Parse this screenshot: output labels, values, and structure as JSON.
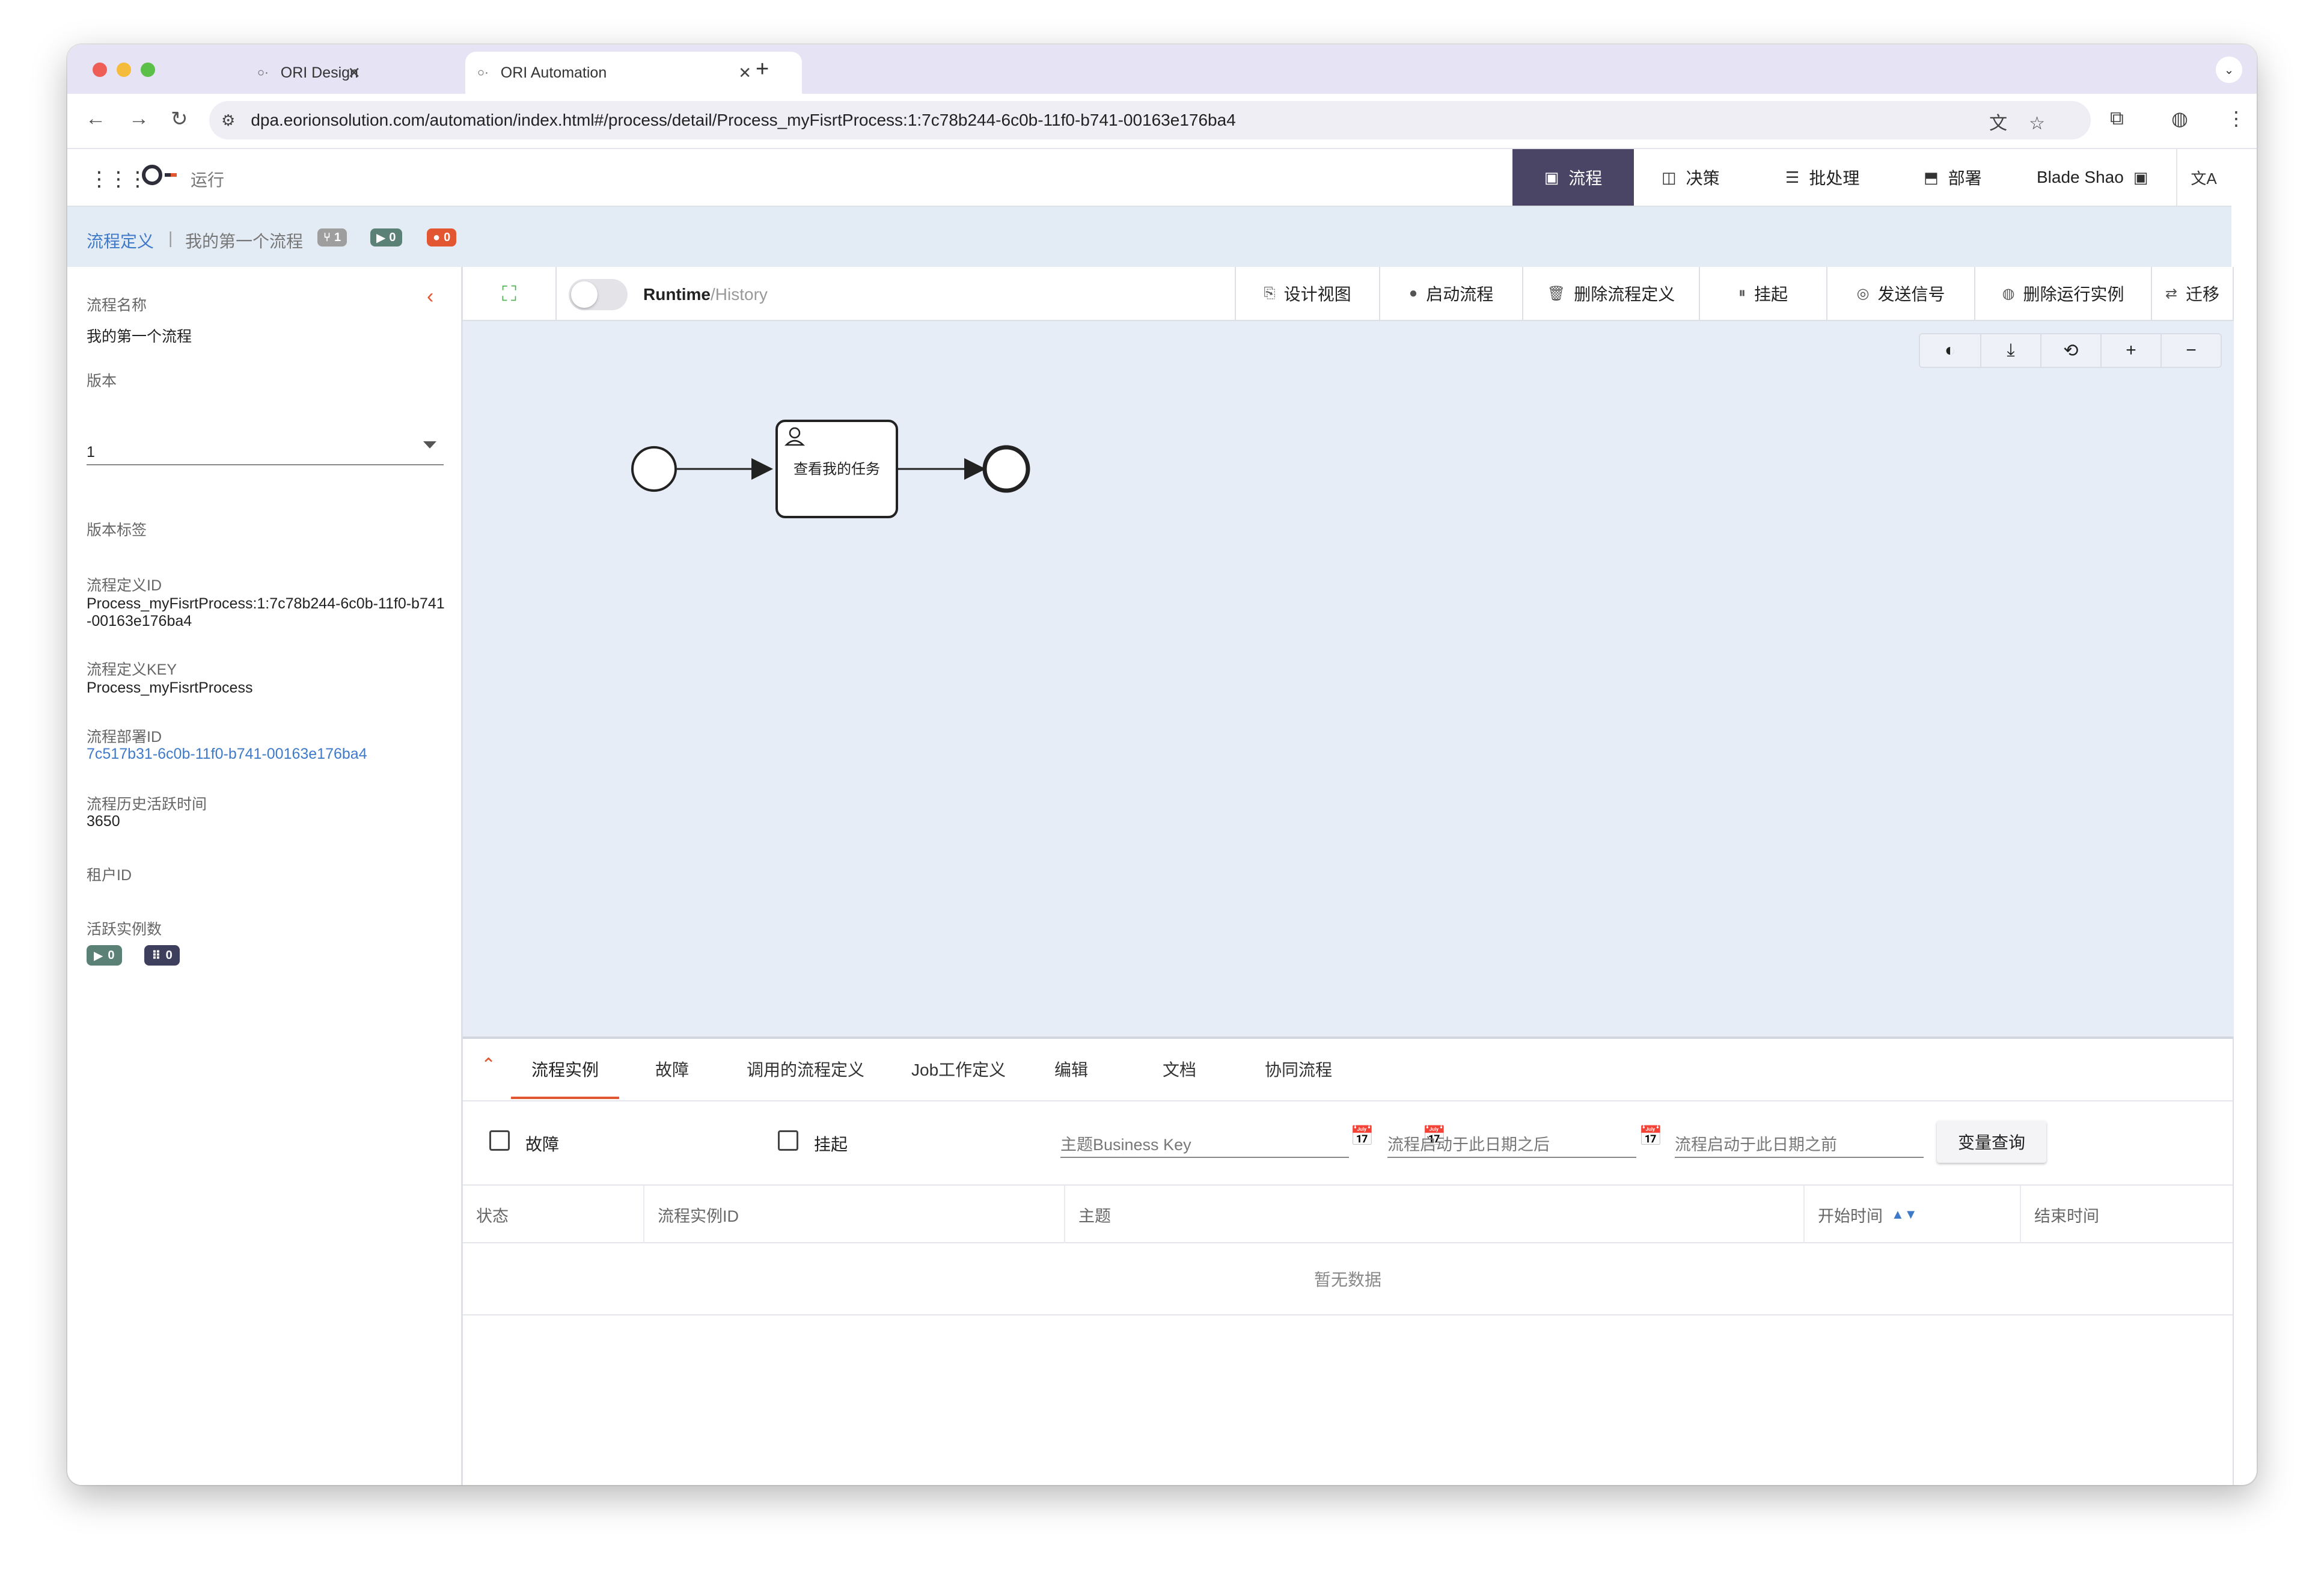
{
  "browser": {
    "tabs": [
      {
        "title": "ORI Design",
        "favicon": "ori-favicon"
      },
      {
        "title": "ORI Automation",
        "favicon": "ori-favicon"
      }
    ],
    "new_tab": "+",
    "url": "dpa.eorionsolution.com/automation/index.html#/process/detail/Process_myFisrtProcess:1:7c78b244-6c0b-11f0-b741-00163e176ba4"
  },
  "app": {
    "logo_label": "运行",
    "nav": [
      {
        "label": "流程",
        "icon": "process-icon",
        "active": true
      },
      {
        "label": "决策",
        "icon": "decision-icon"
      },
      {
        "label": "批处理",
        "icon": "batch-icon"
      },
      {
        "label": "部署",
        "icon": "deploy-icon"
      }
    ],
    "user": "Blade Shao",
    "accent": "#4a4564",
    "link_color": "#3f7ac9",
    "warn_color": "#e35632"
  },
  "breadcrumb": {
    "root": "流程定义",
    "separator": "|",
    "current": "我的第一个流程",
    "badges": [
      {
        "icon": "version-icon",
        "value": "1",
        "color": "#9e9e9e"
      },
      {
        "icon": "play-icon",
        "value": "0",
        "color": "#5b8075"
      },
      {
        "icon": "error-icon",
        "value": "0",
        "color": "#e35632"
      }
    ]
  },
  "details": {
    "name_label": "流程名称",
    "name": "我的第一个流程",
    "version_label": "版本",
    "version": "1",
    "version_tag_label": "版本标签",
    "def_id_label": "流程定义ID",
    "def_id": "Process_myFisrtProcess:1:7c78b244-6c0b-11f0-b741-00163e176ba4",
    "def_key_label": "流程定义KEY",
    "def_key": "Process_myFisrtProcess",
    "deploy_id_label": "流程部署ID",
    "deploy_id": "7c517b31-6c0b-11f0-b741-00163e176ba4",
    "history_ttl_label": "流程历史活跃时间",
    "history_ttl": "3650",
    "tenant_label": "租户ID",
    "active_count_label": "活跃实例数",
    "active_running": "0",
    "active_suspended": "0"
  },
  "toolbar": {
    "runtime": "Runtime",
    "history": "/History",
    "buttons": [
      {
        "label": "设计视图",
        "icon": "design-icon"
      },
      {
        "label": "启动流程",
        "icon": "start-icon"
      },
      {
        "label": "删除流程定义",
        "icon": "delete-icon"
      },
      {
        "label": "挂起",
        "icon": "suspend-icon"
      },
      {
        "label": "发送信号",
        "icon": "signal-icon"
      },
      {
        "label": "删除运行实例",
        "icon": "delete-instance-icon"
      },
      {
        "label": "迁移",
        "icon": "migrate-icon"
      }
    ]
  },
  "diagram": {
    "task_label": "查看我的任务"
  },
  "bottom": {
    "tabs": [
      "流程实例",
      "故障",
      "调用的流程定义",
      "Job工作定义",
      "编辑",
      "文档",
      "协同流程"
    ],
    "active_tab": "流程实例",
    "filters": {
      "incident_label": "故障",
      "suspended_label": "挂起",
      "business_key_placeholder": "主题Business Key",
      "started_after_placeholder": "流程启动于此日期之后",
      "started_before_placeholder": "流程启动于此日期之前",
      "var_query_button": "变量查询"
    },
    "columns": [
      "状态",
      "流程实例ID",
      "主题",
      "开始时间",
      "结束时间"
    ],
    "empty_text": "暂无数据"
  }
}
